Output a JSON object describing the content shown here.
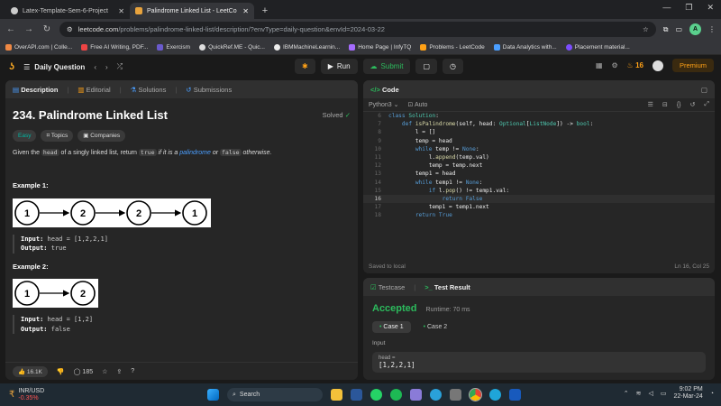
{
  "browser": {
    "tabs": [
      {
        "title": "Latex-Template-Sem-6-Project",
        "active": false
      },
      {
        "title": "Palindrome Linked List - LeetCo",
        "active": true
      }
    ],
    "url_host": "leetcode.com",
    "url_path": "/problems/palindrome-linked-list/description/?envType=daily-question&envId=2024-03-22",
    "profile_initial": "A",
    "bookmarks": [
      "OverAPI.com | Colle...",
      "Free AI Writing, PDF...",
      "Exercism",
      "QuickRef.ME - Quic...",
      "IBMMachineLearnin...",
      "Home Page | InfyTQ",
      "Problems - LeetCode",
      "Data Analytics with...",
      "Placement material..."
    ]
  },
  "leetcode_nav": {
    "section": "Daily Question",
    "run_label": "Run",
    "submit_label": "Submit",
    "streak": "16",
    "premium_label": "Premium"
  },
  "left_panel": {
    "tabs": [
      "Description",
      "Editorial",
      "Solutions",
      "Submissions"
    ],
    "title": "234. Palindrome Linked List",
    "status": "Solved",
    "chips": [
      "Easy",
      "Topics",
      "Companies"
    ],
    "desc": {
      "p1": "Given the ",
      "head": "head",
      "p2": " of a singly linked list, return ",
      "true_code": "true",
      "p3": " if it is a ",
      "palindrome": "palindrome",
      "p4": " or ",
      "false_code": "false",
      "p5": " otherwise."
    },
    "example1": {
      "heading": "Example 1:",
      "nodes": [
        "1",
        "2",
        "2",
        "1"
      ],
      "input_label": "Input:",
      "input_value": " head = [1,2,2,1]",
      "output_label": "Output:",
      "output_value": " true"
    },
    "example2": {
      "heading": "Example 2:",
      "nodes": [
        "1",
        "2"
      ],
      "input_label": "Input:",
      "input_value": " head = [1,2]",
      "output_label": "Output:",
      "output_value": " false"
    },
    "footer": {
      "likes": "16.1K",
      "comments": "185"
    }
  },
  "code_panel": {
    "title": "Code",
    "language": "Python3",
    "auto_label": "Auto",
    "saved_text": "Saved to local",
    "position": "Ln 16, Col 25",
    "first_line": 6
  },
  "result_panel": {
    "tabs": [
      "Testcase",
      "Test Result"
    ],
    "status": "Accepted",
    "runtime": "Runtime: 70 ms",
    "cases": [
      "Case 1",
      "Case 2"
    ],
    "input_label": "Input",
    "var_label": "head =",
    "var_value": "[1,2,2,1]"
  },
  "taskbar": {
    "ticker": "INR/USD",
    "change": "-0.35%",
    "search": "Search",
    "time": "9:02 PM",
    "date": "22-Mar-24"
  }
}
